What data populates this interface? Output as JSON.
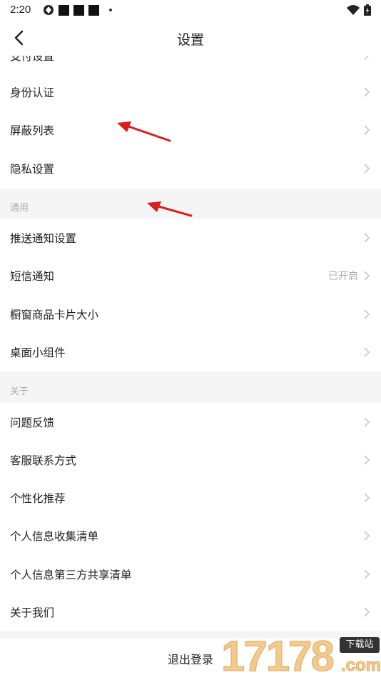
{
  "status_bar": {
    "time": "2:20"
  },
  "header": {
    "title": "设置"
  },
  "partial_item": {
    "label": "支付设置"
  },
  "top_items": [
    {
      "label": "身份认证"
    },
    {
      "label": "屏蔽列表"
    },
    {
      "label": "隐私设置"
    }
  ],
  "general": {
    "section_label": "通用",
    "items": [
      {
        "label": "推送通知设置",
        "value": ""
      },
      {
        "label": "短信通知",
        "value": "已开启"
      },
      {
        "label": "橱窗商品卡片大小",
        "value": ""
      },
      {
        "label": "桌面小组件",
        "value": ""
      }
    ]
  },
  "about": {
    "section_label": "关于",
    "items": [
      {
        "label": "问题反馈"
      },
      {
        "label": "客服联系方式"
      },
      {
        "label": "个性化推荐"
      },
      {
        "label": "个人信息收集清单"
      },
      {
        "label": "个人信息第三方共享清单"
      },
      {
        "label": "关于我们"
      }
    ]
  },
  "logout": {
    "label": "退出登录"
  },
  "watermark": {
    "number": "17178",
    "badge": "下载站",
    "domain": ".com"
  },
  "colors": {
    "accent_arrow": "#e02020",
    "section_bg": "#f5f5f5",
    "muted_text": "#aaaaaa"
  }
}
